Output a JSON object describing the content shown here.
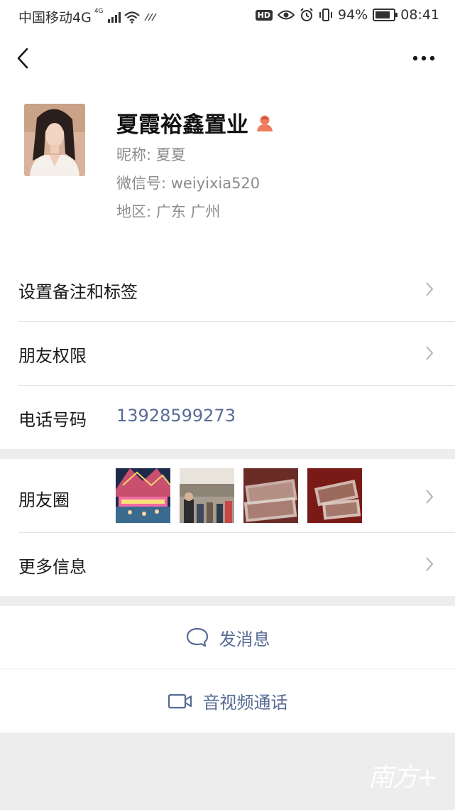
{
  "status_bar": {
    "carrier": "中国移动4G",
    "network_badge": "4G",
    "hd_badge": "HD",
    "battery": "94%",
    "time": "08:41"
  },
  "nav": {
    "back_icon": "chevron-left-icon",
    "more_icon": "more-dots-icon"
  },
  "profile": {
    "name": "夏霞裕鑫置业",
    "nickname": "昵称:  夏夏",
    "wechat_id": "微信号:  weiyixia520",
    "region": "地区:  广东  广州",
    "gender_icon_color": "#f07c5e"
  },
  "menu": {
    "remark_tags": "设置备注和标签",
    "friend_permissions": "朋友权限",
    "phone_label": "电话号码",
    "phone_value": "13928599273",
    "moments_label": "朋友圈",
    "more_info": "更多信息"
  },
  "actions": {
    "send_message": "发消息",
    "video_call": "音视频通话"
  },
  "colors": {
    "accent_link": "#576b95",
    "background": "#ededed"
  },
  "watermark": "南方+"
}
